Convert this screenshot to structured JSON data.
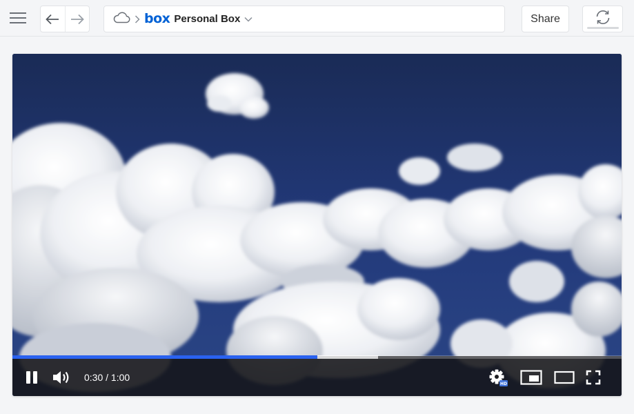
{
  "toolbar": {
    "menu_icon": "hamburger-menu-icon",
    "back_icon": "arrow-left-icon",
    "forward_icon": "arrow-right-icon",
    "breadcrumb": {
      "root_icon": "cloud-icon",
      "separator_icon": "chevron-right-icon",
      "logo_text": "box",
      "title": "Personal Box",
      "caret_icon": "chevron-down-icon"
    },
    "share_label": "Share",
    "sync_icon": "sync-icon"
  },
  "player": {
    "time_display": "0:30 / 1:00",
    "progress_played": 0.5,
    "progress_buffered": 0.6,
    "play_state_icon": "pause-icon",
    "volume_icon": "volume-icon",
    "settings_icon": "settings-gear-icon",
    "settings_badge": "HD",
    "pip_icon": "picture-in-picture-icon",
    "theater_icon": "theater-mode-icon",
    "fullscreen_icon": "fullscreen-icon"
  },
  "colors": {
    "brand": "#0061d5",
    "progress": "#2a62f0",
    "sky": "#243c75"
  }
}
